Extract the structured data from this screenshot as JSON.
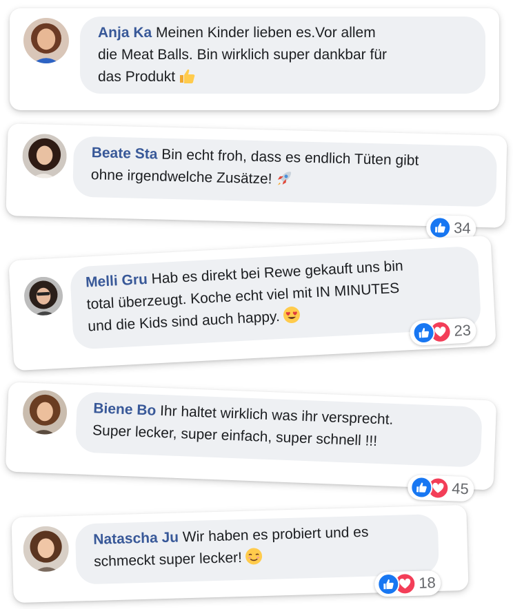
{
  "comments": [
    {
      "name": "Anja Ka",
      "line1": "Meinen Kinder lieben es.Vor allem",
      "line2": "die Meat Balls. Bin wirklich super dankbar für",
      "line3": "das Produkt",
      "emoji": "thumbs-up-emoji"
    },
    {
      "name": "Beate Sta",
      "line1": "Bin echt froh, dass es endlich Tüten gibt",
      "line2": "ohne irgendwelche Zusätze!",
      "emoji": "rocket-emoji",
      "reaction_count": "34"
    },
    {
      "name": "Melli Gru",
      "line1": "Hab es direkt bei Rewe gekauft uns bin",
      "line2": "total überzeugt. Koche echt viel mit IN MINUTES",
      "line3": "und die Kids sind auch happy.",
      "emoji": "heart-eyes-emoji",
      "reaction_count": "23"
    },
    {
      "name": "Biene Bo",
      "line1": "Ihr haltet wirklich was ihr versprecht.",
      "line2": "Super lecker, super einfach, super schnell !!!",
      "reaction_count": "45"
    },
    {
      "name": "Natascha Ju",
      "line1": "Wir haben es probiert und es",
      "line2": "schmeckt super lecker!",
      "emoji": "relieved-emoji",
      "reaction_count": "18"
    }
  ],
  "colors": {
    "name": "#385898",
    "bubble": "#eef0f3",
    "like": "#1877f2",
    "love": "#f33e58"
  }
}
